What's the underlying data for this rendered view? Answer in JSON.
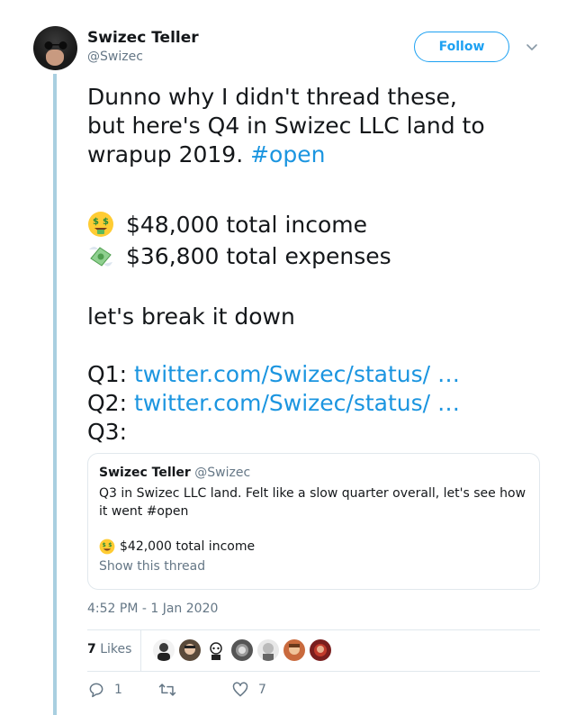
{
  "author": {
    "name": "Swizec Teller",
    "handle": "@Swizec",
    "avatar_icon": "avatar"
  },
  "follow_label": "Follow",
  "tweet": {
    "line1": "Dunno why I didn't thread these,",
    "line2": "but here's Q4 in Swizec LLC land to",
    "line3_text": "wrapup 2019. ",
    "line3_hashtag": "#open",
    "income": "$48,000 total income",
    "expenses": "$36,800 total expenses",
    "breakdown": "let's break it down",
    "q1_label": "Q1: ",
    "q1_link": "twitter.com/Swizec/status/ …",
    "q2_label": "Q2: ",
    "q2_link": "twitter.com/Swizec/status/ …",
    "q3_label": "Q3:"
  },
  "quote": {
    "name": "Swizec Teller",
    "handle": "@Swizec",
    "text": "Q3 in Swizec LLC land. Felt like a slow quarter overall, let's see how it went #open",
    "income": "$42,000 total income",
    "show_thread": "Show this thread"
  },
  "timestamp": "4:52 PM - 1 Jan 2020",
  "likes": {
    "count": "7",
    "label": "Likes"
  },
  "actions": {
    "replies": "1",
    "retweets": "",
    "likes": "7"
  },
  "colors": {
    "accent": "#1da1f2",
    "link": "#1b95e0",
    "muted": "#657786",
    "thread_line": "#a9cfe0"
  }
}
